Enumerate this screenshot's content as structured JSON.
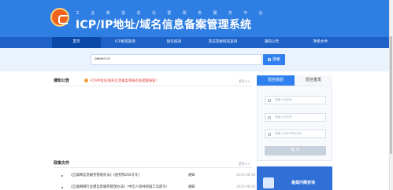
{
  "header": {
    "subtitle": "工 业 和 信 息 化 部 政 务 服 务 平 台",
    "title": "ICP/IP地址/域名信息备案管理系统"
  },
  "nav": {
    "items": [
      {
        "label": "首页",
        "active": true
      },
      {
        "label": "ICP备案查询",
        "active": false
      },
      {
        "label": "短信核验",
        "active": false
      },
      {
        "label": "违法违规域名查询",
        "active": false
      },
      {
        "label": "通知公告",
        "active": false
      },
      {
        "label": "政策文件",
        "active": false
      }
    ]
  },
  "search": {
    "value": "owser.cn",
    "button_label": "搜索"
  },
  "notice": {
    "section_title": "通知公告",
    "more_label": "更多>>",
    "items": [
      "ICP/IP地址/域名信息备案系统有关提醒通知！"
    ]
  },
  "policy": {
    "section_title": "政策文件",
    "more_label": "更多>>",
    "items": [
      {
        "title": "《互联网信息服务管理办法》(国务院292号令)",
        "type": "通知",
        "date": "2020-08-16 10:53:47"
      },
      {
        "title": "《互联网网行业健信息服务管理办法》（中华人民共和国工信部令）",
        "type": "通知",
        "date": "2020-08-16 10:53:47"
      }
    ]
  },
  "sms": {
    "tab_active": "短信核验",
    "tab_inactive": "短信重发",
    "field1_placeholder": "请输入验证码",
    "field2_placeholder": "请输入手机号",
    "field3_placeholder": "请输入证件号码后6位",
    "submit_label": "提 交"
  },
  "promo": {
    "label": "备案问题咨询"
  },
  "colors": {
    "header_blue": "#2f7ee3",
    "nav_blue": "#1e62c8",
    "accent_blue": "#2f80ee",
    "notice_red": "#e0403e",
    "logo_orange": "#f0631c"
  }
}
